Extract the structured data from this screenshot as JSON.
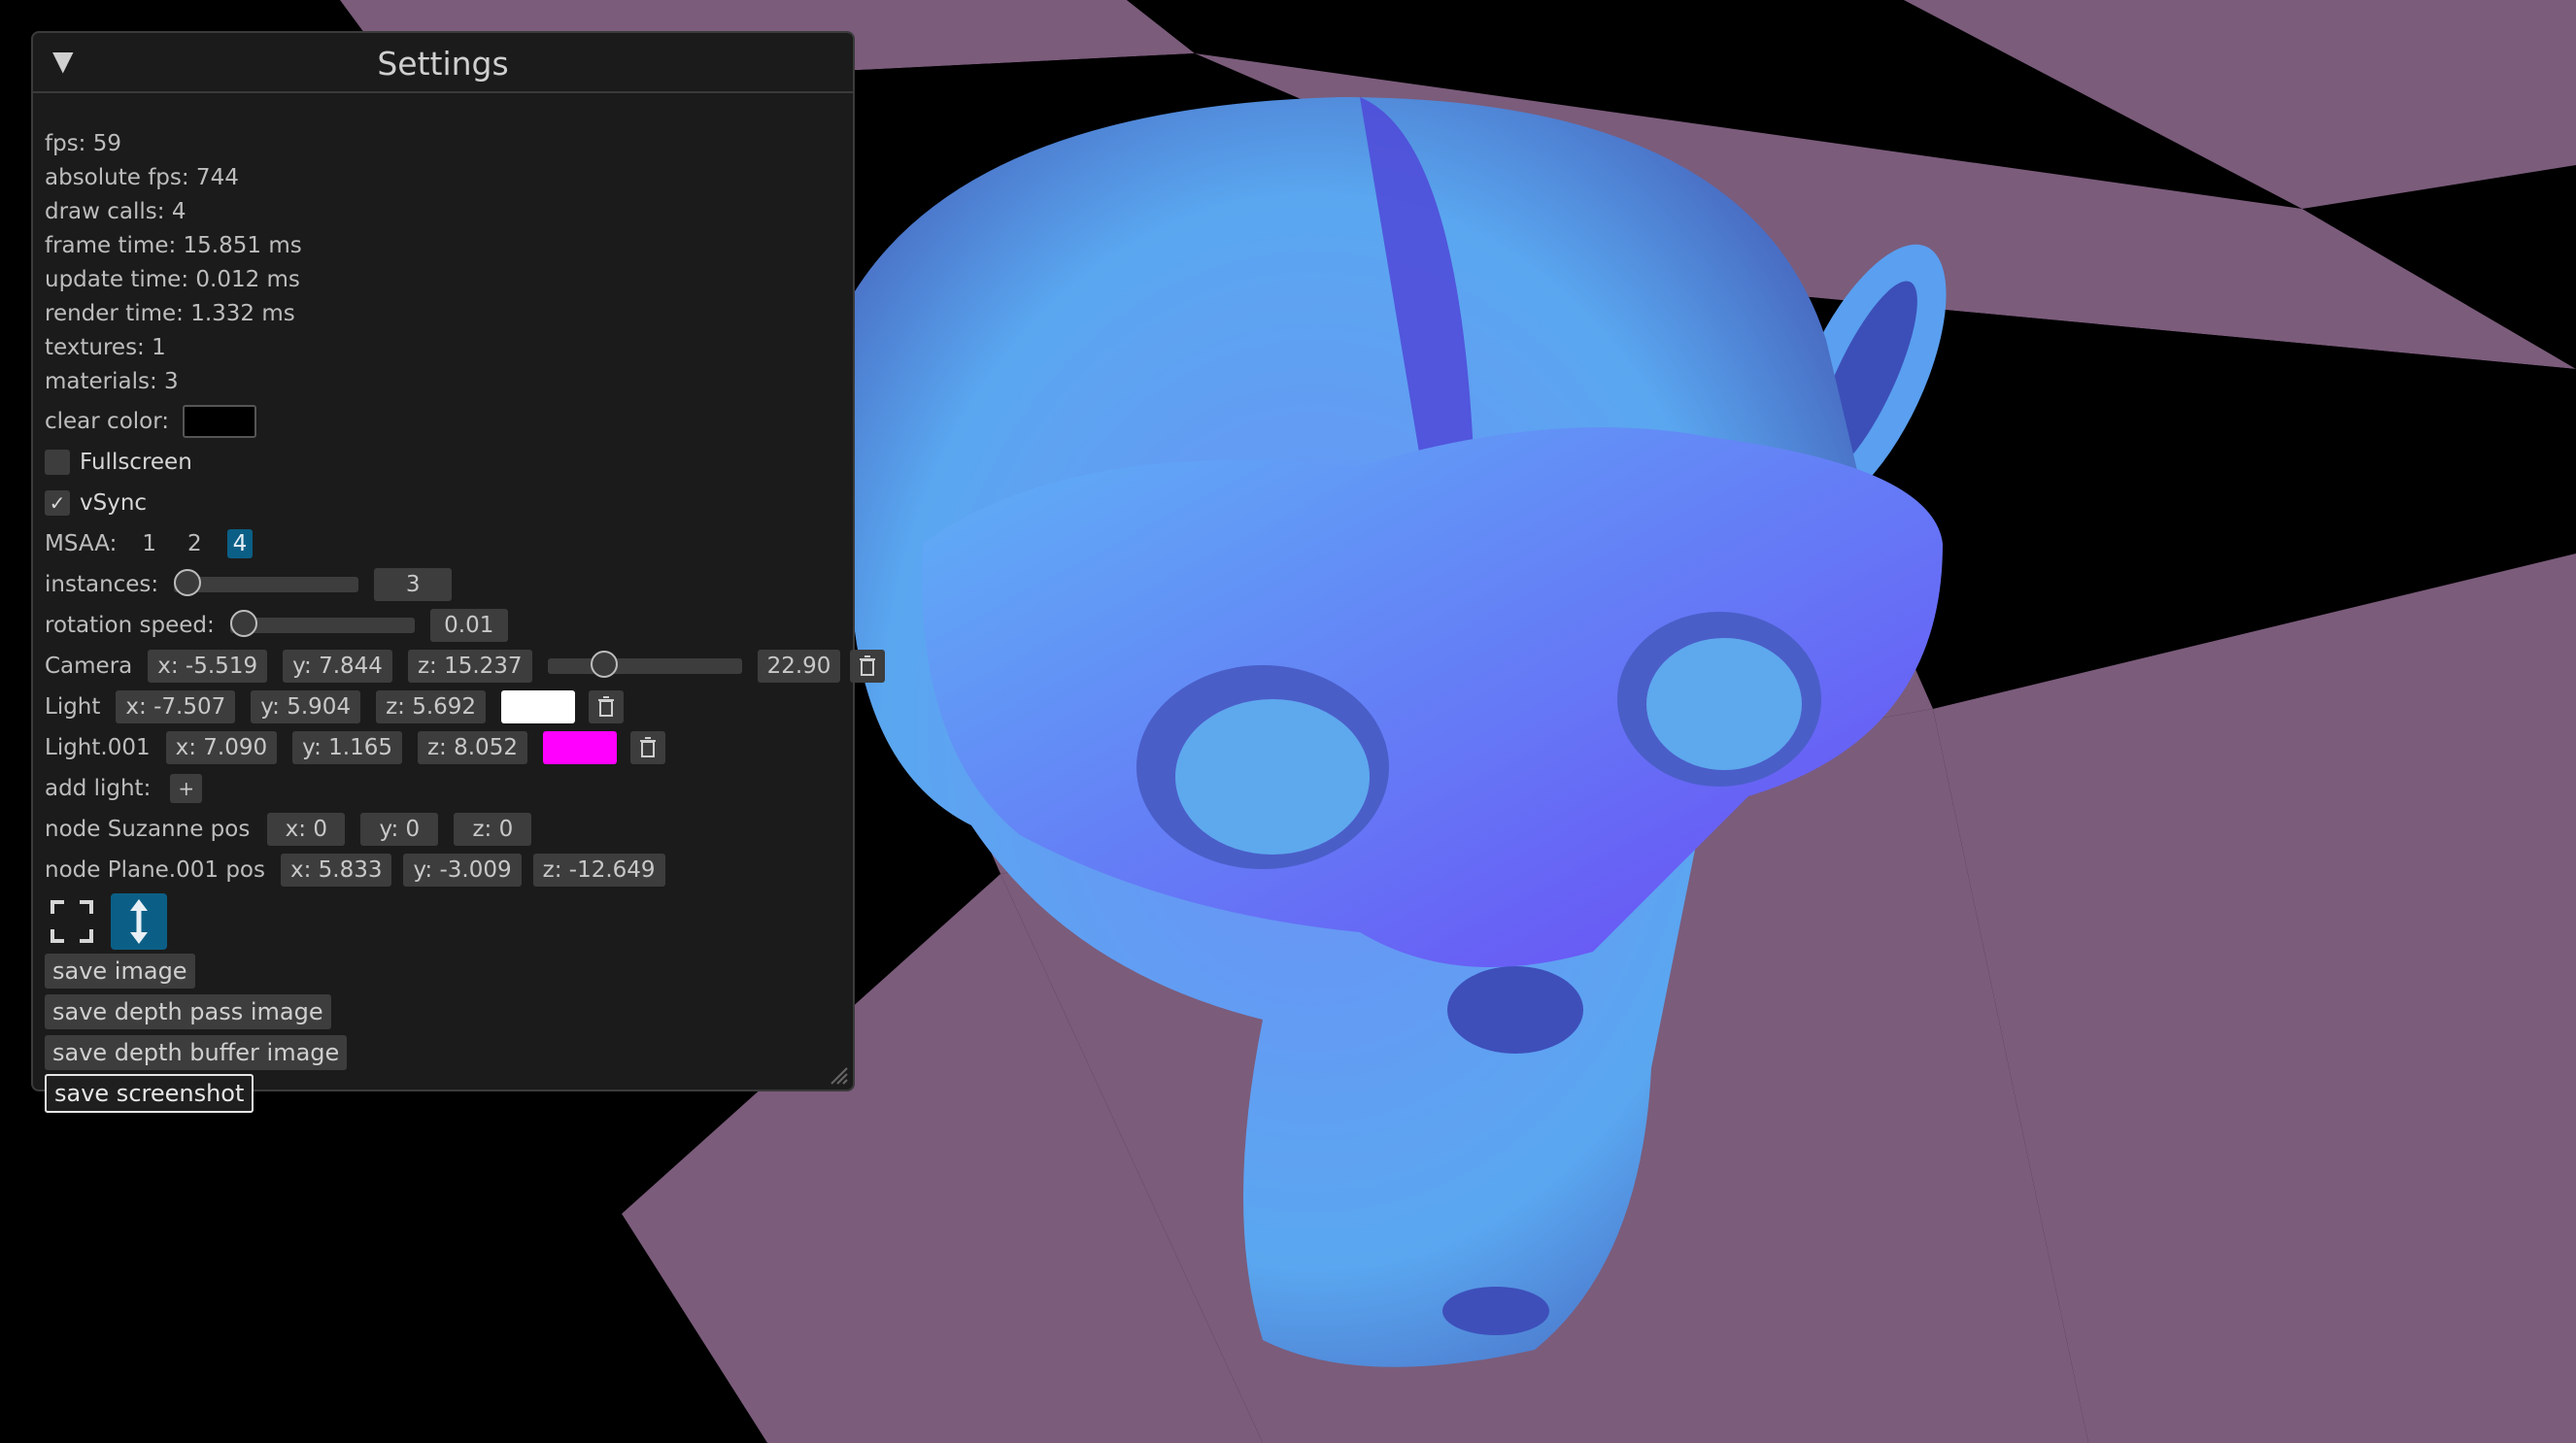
{
  "window": {
    "title": "Settings",
    "collapse_icon": "triangle-down-icon"
  },
  "stats": {
    "fps": "fps: 59",
    "absolute_fps": "absolute fps: 744",
    "draw_calls": "draw calls: 4",
    "frame_time": "frame time: 15.851 ms",
    "update_time": "update time: 0.012 ms",
    "render_time": "render time: 1.332 ms",
    "textures": "textures: 1",
    "materials": "materials: 3"
  },
  "clear_color": {
    "label": "clear color:",
    "value": "#000000"
  },
  "fullscreen": {
    "label": "Fullscreen",
    "checked": false
  },
  "vsync": {
    "label": "vSync",
    "checked": true,
    "check_glyph": "✓"
  },
  "msaa": {
    "label": "MSAA:",
    "options": [
      "1",
      "2",
      "4"
    ],
    "selected": "4"
  },
  "instances": {
    "label": "instances:",
    "value": "3",
    "level": 0.0
  },
  "rotation_speed": {
    "label": "rotation speed:",
    "value": "0.01",
    "level": 0.0
  },
  "camera": {
    "label": "Camera",
    "x": "x: -5.519",
    "y": "y: 7.844",
    "z": "z: 15.237",
    "fov": "22.90",
    "fov_level": 0.29
  },
  "light": {
    "label": "Light",
    "x": "x: -7.507",
    "y": "y: 5.904",
    "z": "z: 5.692",
    "color": "#ffffff"
  },
  "light001": {
    "label": "Light.001",
    "x": "x: 7.090",
    "y": "y: 1.165",
    "z": "z: 8.052",
    "color": "#ff00ff"
  },
  "add_light": {
    "label": "add light:",
    "button": "+"
  },
  "node_suzanne": {
    "label": "node Suzanne pos",
    "x": "x: 0",
    "y": "y: 0",
    "z": "z: 0"
  },
  "node_plane": {
    "label": "node Plane.001 pos",
    "x": "x: 5.833",
    "y": "y: -3.009",
    "z": "z: -12.649"
  },
  "gizmo": {
    "translate_icon": "fullscreen-bracket-icon",
    "scale_icon": "vertical-arrows-icon"
  },
  "buttons": {
    "save_image": "save image",
    "save_depth_pass": "save depth pass image",
    "save_depth_buffer": "save depth buffer image",
    "save_screenshot": "save screenshot"
  },
  "colors": {
    "accent": "#0b5f86",
    "floor_light": "#7b5c7b",
    "floor_dark": "#000000",
    "model_blue": "#5aa7f0",
    "model_violet": "#6b46f2"
  }
}
